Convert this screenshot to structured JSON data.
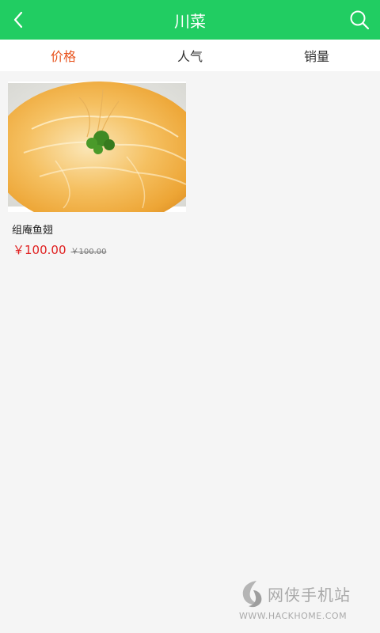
{
  "header": {
    "title": "川菜"
  },
  "icons": {
    "back": "chevron-left-icon",
    "search": "search-icon"
  },
  "tabs": [
    {
      "label": "价格",
      "active": true
    },
    {
      "label": "人气",
      "active": false
    },
    {
      "label": "销量",
      "active": false
    }
  ],
  "products": [
    {
      "name": "组庵鱼翅",
      "price": "￥100.00",
      "original_price": "￥100.00"
    }
  ],
  "watermark": {
    "brand": "网侠手机站",
    "url": "WWW.HACKHOME.COM"
  },
  "colors": {
    "header": "#21cd62",
    "active_tab": "#e8541e",
    "price": "#e02020",
    "background": "#f5f5f5"
  }
}
